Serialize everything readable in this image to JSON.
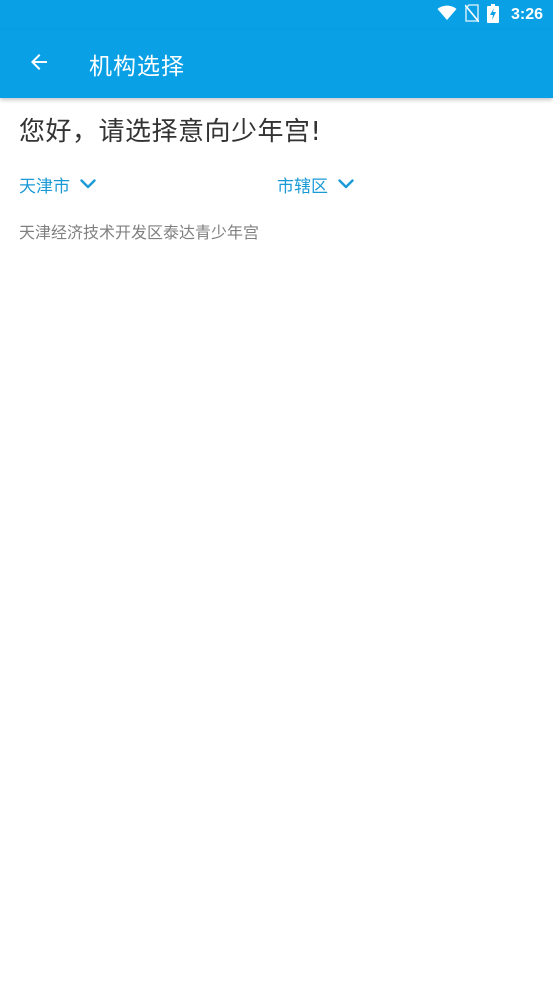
{
  "status_bar": {
    "time": "3:26",
    "icons": [
      "wifi-icon",
      "no-sim-icon",
      "battery-charging-icon"
    ]
  },
  "app_bar": {
    "title": "机构选择",
    "back_icon": "arrow-back-icon"
  },
  "greeting": "您好，请选择意向少年宫!",
  "filters": {
    "city": {
      "value": "天津市",
      "icon": "chevron-down-icon"
    },
    "district": {
      "value": "市辖区",
      "icon": "chevron-down-icon"
    }
  },
  "organizations": [
    {
      "name": "天津经济技术开发区泰达青少年宫"
    }
  ],
  "colors": {
    "primary": "#0aa0e6",
    "accent_text": "#1a9ad6",
    "heading_text": "#333333",
    "item_text": "#808080"
  }
}
